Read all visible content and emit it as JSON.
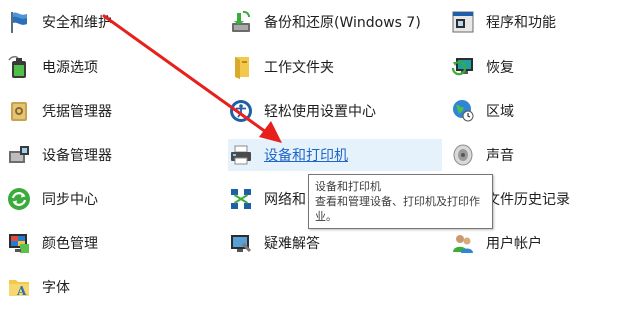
{
  "control_panel": {
    "column1": [
      {
        "label": "安全和维护",
        "icon": "flag-icon"
      },
      {
        "label": "电源选项",
        "icon": "battery-icon"
      },
      {
        "label": "凭据管理器",
        "icon": "credential-vault-icon"
      },
      {
        "label": "设备管理器",
        "icon": "device-manager-icon"
      },
      {
        "label": "同步中心",
        "icon": "sync-icon"
      },
      {
        "label": "颜色管理",
        "icon": "color-management-icon"
      },
      {
        "label": "字体",
        "icon": "font-folder-icon"
      }
    ],
    "column2": [
      {
        "label": "备份和还原(Windows 7)",
        "icon": "backup-icon"
      },
      {
        "label": "工作文件夹",
        "icon": "work-folder-icon"
      },
      {
        "label": "轻松使用设置中心",
        "icon": "ease-of-access-icon"
      },
      {
        "label": "设备和打印机",
        "icon": "printer-icon"
      },
      {
        "label": "网络和",
        "icon": "network-icon"
      },
      {
        "label": "疑难解答",
        "icon": "troubleshoot-icon"
      }
    ],
    "column3": [
      {
        "label": "程序和功能",
        "icon": "programs-icon"
      },
      {
        "label": "恢复",
        "icon": "recovery-icon"
      },
      {
        "label": "区域",
        "icon": "region-globe-icon"
      },
      {
        "label": "声音",
        "icon": "speaker-icon"
      },
      {
        "label": "文件历史记录",
        "icon": "file-history-icon"
      },
      {
        "label": "用户帐户",
        "icon": "user-accounts-icon"
      }
    ]
  },
  "tooltip": {
    "title": "设备和打印机",
    "description": "查看和管理设备、打印机及打印作业。"
  },
  "annotation": {
    "arrow_color": "#e8201c"
  },
  "colors": {
    "hover_background": "#e5f1fb",
    "link_hover": "#1e66c8"
  }
}
